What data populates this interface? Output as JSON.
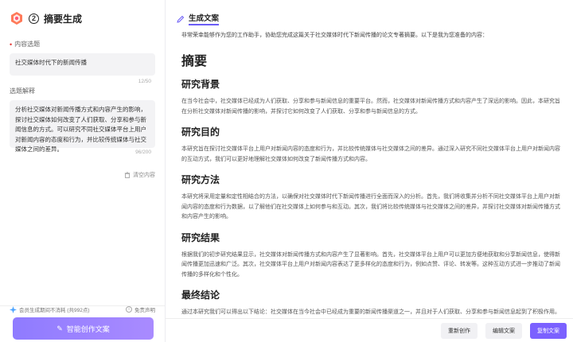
{
  "left": {
    "step_number": "2",
    "title": "摘要生成",
    "topic_label": "内容选题",
    "topic_value": "社交媒体时代下的新闻传播",
    "topic_count": "12/50",
    "desc_label": "选题解释",
    "desc_value": "分析社交媒体对新闻传播方式和内容产生的影响，探讨社交媒体如何改变了人们获取、分享和参与新闻信息的方式。可以研究不同社交媒体平台上用户对新闻内容的态度和行为，并比较传统媒体与社交媒体之间的差异。",
    "desc_count": "96/200",
    "clear_label": "清空内容",
    "usage_text": "会员生成期间不消耗 (共992点)",
    "disclaimer_label": "免责声明",
    "generate_button": "智能创作文案",
    "accent_color": "#8f7bff"
  },
  "right": {
    "title": "生成文案",
    "intro": "非常荣幸能够作为您的工作助手，协助您完成这篇关于社交媒体时代下新闻传播的论文专著摘要。以下是我为您准备的内容：",
    "heading": "摘要",
    "sections": [
      {
        "title": "研究背景",
        "text": "在当今社会中，社交媒体已经成为人们获取、分享和参与新闻信息的重要平台。然而，社交媒体对新闻传播方式和内容产生了深远的影响。因此，本研究旨在分析社交媒体对新闻传播的影响，并探讨它如何改变了人们获取、分享和参与新闻信息的方式。"
      },
      {
        "title": "研究目的",
        "text": "本研究旨在探讨社交媒体平台上用户对新闻内容的态度和行为，并比较传统媒体与社交媒体之间的差异。通过深入研究不同社交媒体平台上用户对新闻内容的互动方式，我们可以更好地理解社交媒体如何改变了新闻传播方式和内容。"
      },
      {
        "title": "研究方法",
        "text": "本研究将采用定量和定性相结合的方法，以确保对社交媒体时代下新闻传播进行全面而深入的分析。首先，我们将收集并分析不同社交媒体平台上用户对新闻内容的态度和行为数据，以了解他们在社交媒体上如何参与和互动。其次，我们将比较传统媒体与社交媒体之间的差异，并探讨社交媒体对新闻传播方式和内容产生的影响。"
      },
      {
        "title": "研究结果",
        "text": "根据我们的初步研究结果显示，社交媒体对新闻传播方式和内容产生了显著影响。首先，社交媒体平台上用户可以更加方便地获取和分享新闻信息，使得新闻传播更加迅速和广泛。其次，社交媒体平台上用户对新闻内容表达了更多样化的态度和行为，例如点赞、评论、转发等。这种互动方式进一步推动了新闻传播的多样化和个性化。"
      },
      {
        "title": "最终结论",
        "text": "通过本研究我们可以得出以下结论：社交媒体在当今社会中已经成为重要的新闻传播渠道之一，并且对于人们获取、分享和参与新闻信息起到了积极作用。然而，在享受这些便利的同时也应该注意其中存在的问题，例如虚假信息的传播和个人隐私的泄露等。因此，我们需要进一步研究和探索如何"
      }
    ],
    "buttons": {
      "regenerate": "重新创作",
      "edit": "编辑文案",
      "copy": "复制文案"
    },
    "accent_color": "#7b61ff"
  }
}
